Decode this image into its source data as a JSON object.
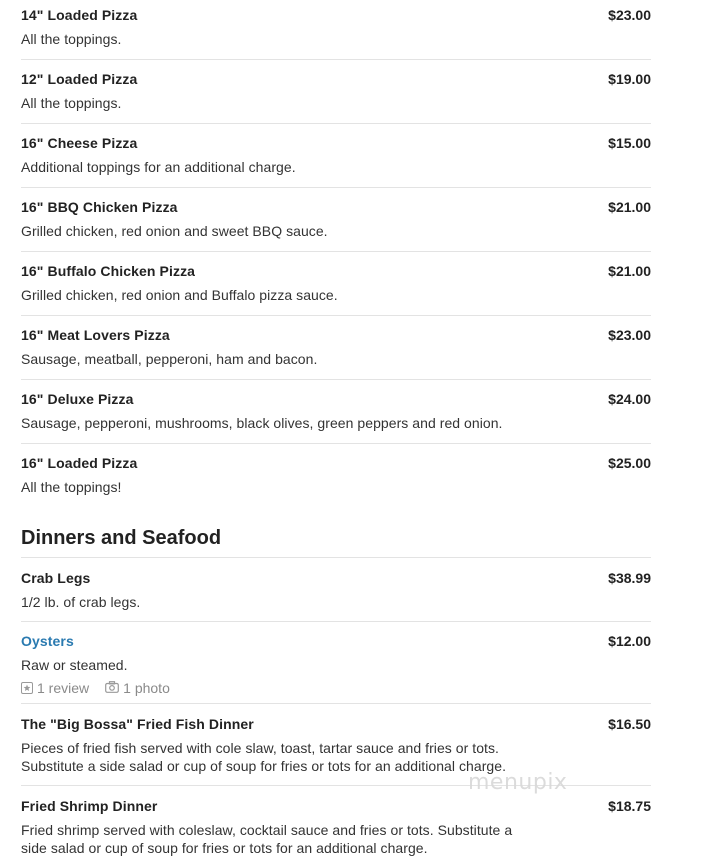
{
  "pizzas": [
    {
      "name": "14\" Loaded Pizza",
      "price": "$23.00",
      "desc": "All the toppings."
    },
    {
      "name": "12\" Loaded Pizza",
      "price": "$19.00",
      "desc": "All the toppings."
    },
    {
      "name": "16\" Cheese Pizza",
      "price": "$15.00",
      "desc": "Additional toppings for an additional charge."
    },
    {
      "name": "16\" BBQ Chicken Pizza",
      "price": "$21.00",
      "desc": "Grilled chicken, red onion and sweet BBQ sauce."
    },
    {
      "name": "16\" Buffalo Chicken Pizza",
      "price": "$21.00",
      "desc": "Grilled chicken, red onion and Buffalo pizza sauce."
    },
    {
      "name": "16\" Meat Lovers Pizza",
      "price": "$23.00",
      "desc": "Sausage, meatball, pepperoni, ham and bacon."
    },
    {
      "name": "16\" Deluxe Pizza",
      "price": "$24.00",
      "desc": "Sausage, pepperoni, mushrooms, black olives, green peppers and red onion."
    },
    {
      "name": "16\" Loaded Pizza",
      "price": "$25.00",
      "desc": "All the toppings!"
    }
  ],
  "dinners_section": {
    "title": "Dinners and Seafood",
    "items": [
      {
        "name": "Crab Legs",
        "price": "$38.99",
        "desc": "1/2 lb. of crab legs."
      },
      {
        "name": "Oysters",
        "price": "$12.00",
        "desc": "Raw or steamed.",
        "reviews": "1 review",
        "photos": "1 photo"
      },
      {
        "name": "The \"Big Bossa\" Fried Fish Dinner",
        "price": "$16.50",
        "desc_line1": "Pieces of fried fish served with cole slaw, toast, tartar sauce and fries or tots.",
        "desc_line2": "Substitute a side salad or cup of soup for fries or tots for an additional charge."
      },
      {
        "name": "Fried Shrimp Dinner",
        "price": "$18.75",
        "desc_line1": "Fried shrimp served with coleslaw, cocktail sauce and fries or tots. Substitute a",
        "desc_line2": "side salad or cup of soup for fries or tots for an additional charge."
      }
    ]
  },
  "watermark": "menupix",
  "colors": {
    "link": "#2a7ab0",
    "divider": "#e3e3e3",
    "meta": "#8a8a8a"
  },
  "icons": {
    "review": "star-box-icon",
    "photo": "camera-icon"
  }
}
